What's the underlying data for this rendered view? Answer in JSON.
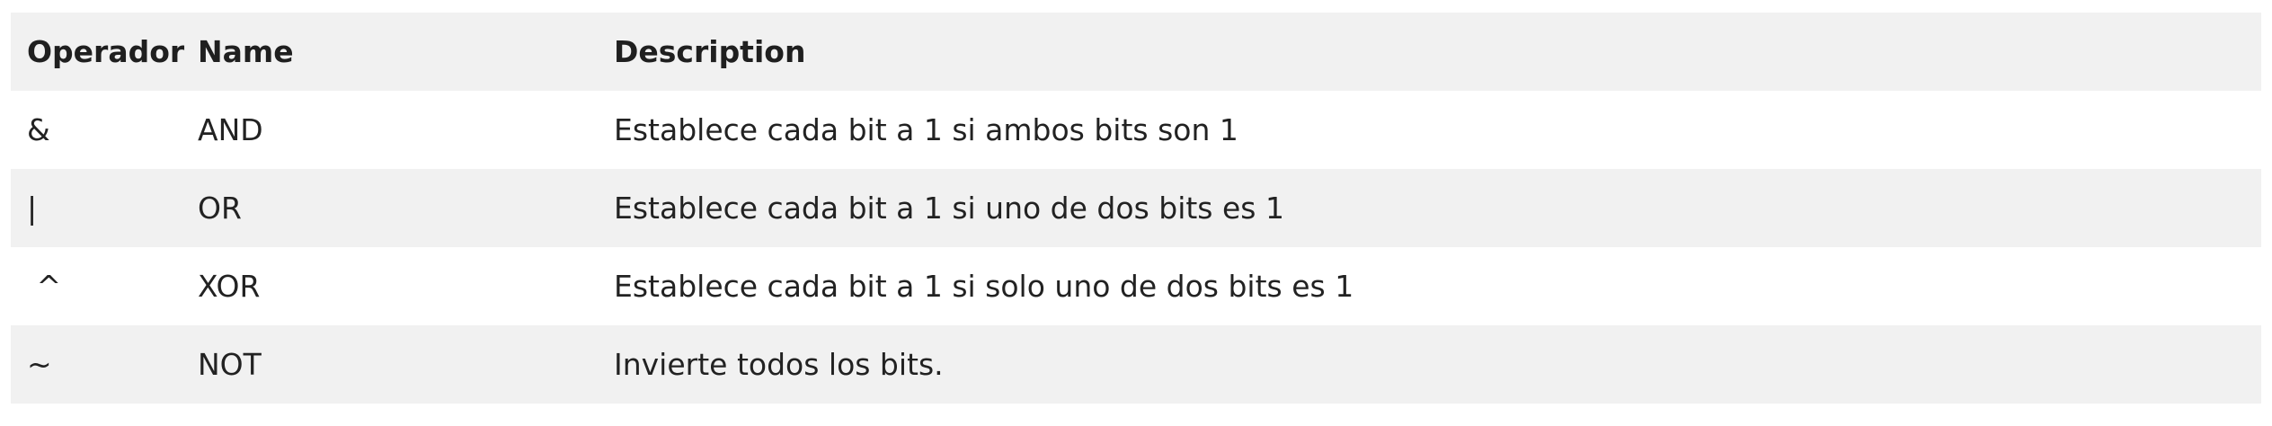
{
  "table": {
    "headers": {
      "operator": "Operador",
      "name": "Name",
      "description": "Description"
    },
    "rows": [
      {
        "operator": "&",
        "name": "AND",
        "description": "Establece cada bit a 1 si ambos bits son 1"
      },
      {
        "operator": "|",
        "name": "OR",
        "description": "Establece cada bit a 1 si uno de dos bits es 1"
      },
      {
        "operator": " ^",
        "name": "XOR",
        "description": "Establece cada bit a 1 si solo uno de dos bits es 1"
      },
      {
        "operator": "~",
        "name": "NOT",
        "description": "Invierte todos los bits."
      }
    ]
  }
}
